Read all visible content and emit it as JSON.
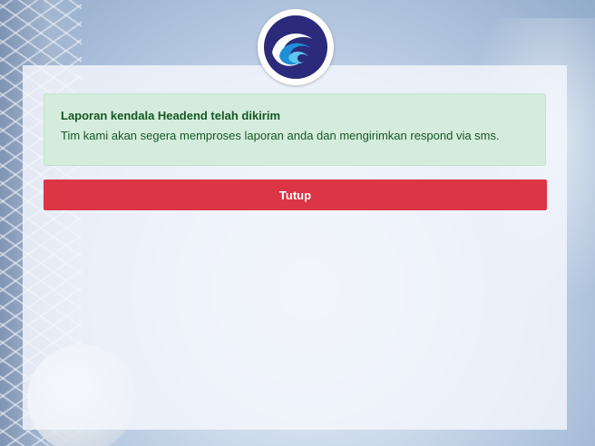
{
  "logo": {
    "icon": "kominfo-logo-icon"
  },
  "alert": {
    "title": "Laporan kendala Headend telah dikirim",
    "message": "Tim kami akan segera memproses laporan anda dan mengirimkan respond via sms."
  },
  "actions": {
    "close_label": "Tutup"
  },
  "colors": {
    "alert_bg": "#d4ecdc",
    "alert_text": "#155724",
    "button_bg": "#dc3545",
    "button_text": "#ffffff"
  }
}
